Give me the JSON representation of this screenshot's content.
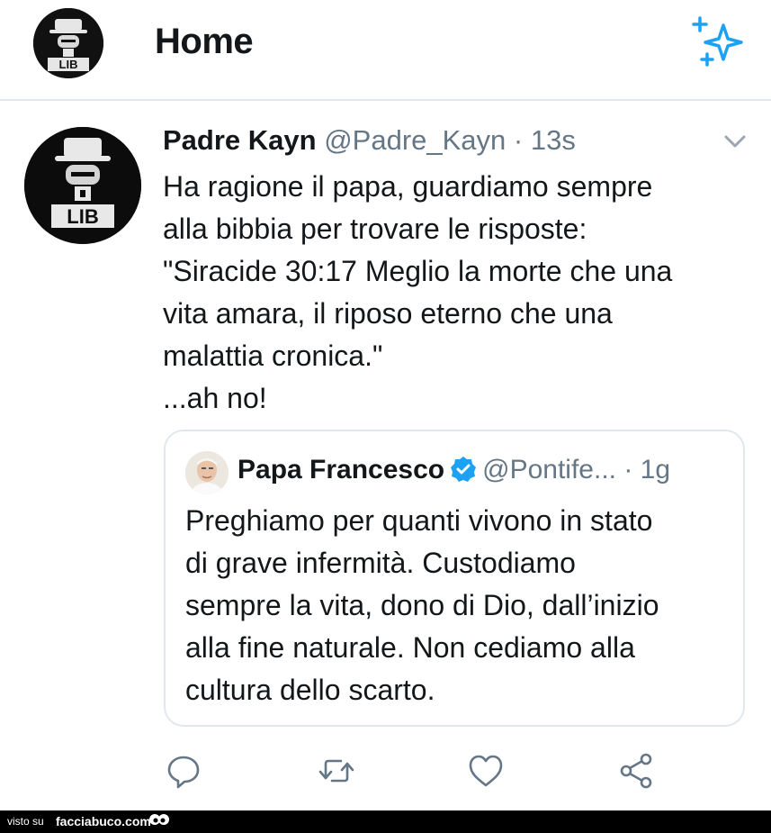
{
  "header": {
    "title": "Home",
    "avatar_text": "LIB"
  },
  "tweet": {
    "display_name": "Padre Kayn",
    "handle": "@Padre_Kayn",
    "separator": " · ",
    "time": "13s",
    "avatar_text": "LIB",
    "text_lines": [
      "Ha ragione il papa, guardiamo sempre",
      "alla bibbia per trovare le risposte:",
      "\"Siracide 30:17 Meglio la morte che una",
      "vita amara, il riposo eterno che una",
      "malattia cronica.\"",
      "...ah no!"
    ]
  },
  "quote": {
    "display_name": "Papa Francesco",
    "handle": "@Pontife...",
    "separator": " · ",
    "time": "1g",
    "text_lines": [
      "Preghiamo per quanti vivono in stato",
      "di grave infermità. Custodiamo",
      "sempre la vita, dono di Dio, dall’inizio",
      "alla fine naturale. Non cediamo alla",
      "cultura dello scarto."
    ]
  },
  "actions": [
    "reply-icon",
    "retweet-icon",
    "like-icon",
    "share-icon"
  ],
  "footer": {
    "visto_su": "visto su",
    "site": "facciabuco.com"
  },
  "colors": {
    "accent": "#1da1f2",
    "secondary_text": "#657786",
    "border": "#e1e8ed"
  }
}
